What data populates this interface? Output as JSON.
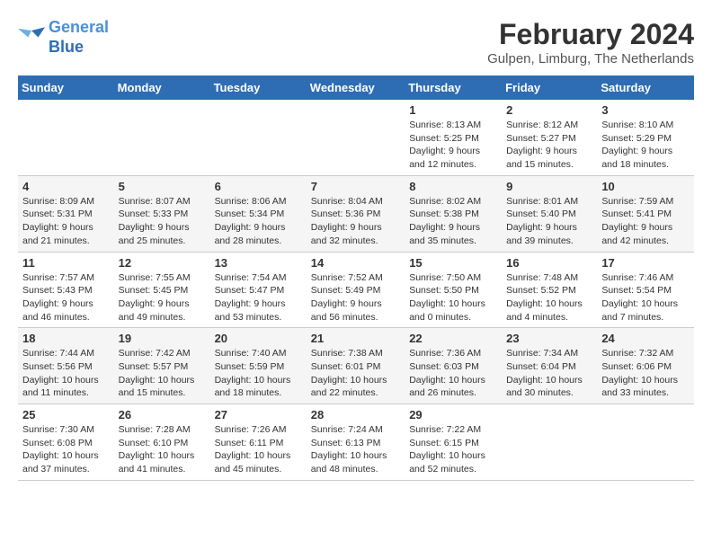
{
  "header": {
    "logo_line1": "General",
    "logo_line2": "Blue",
    "title": "February 2024",
    "location": "Gulpen, Limburg, The Netherlands"
  },
  "days_of_week": [
    "Sunday",
    "Monday",
    "Tuesday",
    "Wednesday",
    "Thursday",
    "Friday",
    "Saturday"
  ],
  "weeks": [
    [
      {
        "day": "",
        "info": ""
      },
      {
        "day": "",
        "info": ""
      },
      {
        "day": "",
        "info": ""
      },
      {
        "day": "",
        "info": ""
      },
      {
        "day": "1",
        "info": "Sunrise: 8:13 AM\nSunset: 5:25 PM\nDaylight: 9 hours\nand 12 minutes."
      },
      {
        "day": "2",
        "info": "Sunrise: 8:12 AM\nSunset: 5:27 PM\nDaylight: 9 hours\nand 15 minutes."
      },
      {
        "day": "3",
        "info": "Sunrise: 8:10 AM\nSunset: 5:29 PM\nDaylight: 9 hours\nand 18 minutes."
      }
    ],
    [
      {
        "day": "4",
        "info": "Sunrise: 8:09 AM\nSunset: 5:31 PM\nDaylight: 9 hours\nand 21 minutes."
      },
      {
        "day": "5",
        "info": "Sunrise: 8:07 AM\nSunset: 5:33 PM\nDaylight: 9 hours\nand 25 minutes."
      },
      {
        "day": "6",
        "info": "Sunrise: 8:06 AM\nSunset: 5:34 PM\nDaylight: 9 hours\nand 28 minutes."
      },
      {
        "day": "7",
        "info": "Sunrise: 8:04 AM\nSunset: 5:36 PM\nDaylight: 9 hours\nand 32 minutes."
      },
      {
        "day": "8",
        "info": "Sunrise: 8:02 AM\nSunset: 5:38 PM\nDaylight: 9 hours\nand 35 minutes."
      },
      {
        "day": "9",
        "info": "Sunrise: 8:01 AM\nSunset: 5:40 PM\nDaylight: 9 hours\nand 39 minutes."
      },
      {
        "day": "10",
        "info": "Sunrise: 7:59 AM\nSunset: 5:41 PM\nDaylight: 9 hours\nand 42 minutes."
      }
    ],
    [
      {
        "day": "11",
        "info": "Sunrise: 7:57 AM\nSunset: 5:43 PM\nDaylight: 9 hours\nand 46 minutes."
      },
      {
        "day": "12",
        "info": "Sunrise: 7:55 AM\nSunset: 5:45 PM\nDaylight: 9 hours\nand 49 minutes."
      },
      {
        "day": "13",
        "info": "Sunrise: 7:54 AM\nSunset: 5:47 PM\nDaylight: 9 hours\nand 53 minutes."
      },
      {
        "day": "14",
        "info": "Sunrise: 7:52 AM\nSunset: 5:49 PM\nDaylight: 9 hours\nand 56 minutes."
      },
      {
        "day": "15",
        "info": "Sunrise: 7:50 AM\nSunset: 5:50 PM\nDaylight: 10 hours\nand 0 minutes."
      },
      {
        "day": "16",
        "info": "Sunrise: 7:48 AM\nSunset: 5:52 PM\nDaylight: 10 hours\nand 4 minutes."
      },
      {
        "day": "17",
        "info": "Sunrise: 7:46 AM\nSunset: 5:54 PM\nDaylight: 10 hours\nand 7 minutes."
      }
    ],
    [
      {
        "day": "18",
        "info": "Sunrise: 7:44 AM\nSunset: 5:56 PM\nDaylight: 10 hours\nand 11 minutes."
      },
      {
        "day": "19",
        "info": "Sunrise: 7:42 AM\nSunset: 5:57 PM\nDaylight: 10 hours\nand 15 minutes."
      },
      {
        "day": "20",
        "info": "Sunrise: 7:40 AM\nSunset: 5:59 PM\nDaylight: 10 hours\nand 18 minutes."
      },
      {
        "day": "21",
        "info": "Sunrise: 7:38 AM\nSunset: 6:01 PM\nDaylight: 10 hours\nand 22 minutes."
      },
      {
        "day": "22",
        "info": "Sunrise: 7:36 AM\nSunset: 6:03 PM\nDaylight: 10 hours\nand 26 minutes."
      },
      {
        "day": "23",
        "info": "Sunrise: 7:34 AM\nSunset: 6:04 PM\nDaylight: 10 hours\nand 30 minutes."
      },
      {
        "day": "24",
        "info": "Sunrise: 7:32 AM\nSunset: 6:06 PM\nDaylight: 10 hours\nand 33 minutes."
      }
    ],
    [
      {
        "day": "25",
        "info": "Sunrise: 7:30 AM\nSunset: 6:08 PM\nDaylight: 10 hours\nand 37 minutes."
      },
      {
        "day": "26",
        "info": "Sunrise: 7:28 AM\nSunset: 6:10 PM\nDaylight: 10 hours\nand 41 minutes."
      },
      {
        "day": "27",
        "info": "Sunrise: 7:26 AM\nSunset: 6:11 PM\nDaylight: 10 hours\nand 45 minutes."
      },
      {
        "day": "28",
        "info": "Sunrise: 7:24 AM\nSunset: 6:13 PM\nDaylight: 10 hours\nand 48 minutes."
      },
      {
        "day": "29",
        "info": "Sunrise: 7:22 AM\nSunset: 6:15 PM\nDaylight: 10 hours\nand 52 minutes."
      },
      {
        "day": "",
        "info": ""
      },
      {
        "day": "",
        "info": ""
      }
    ]
  ]
}
